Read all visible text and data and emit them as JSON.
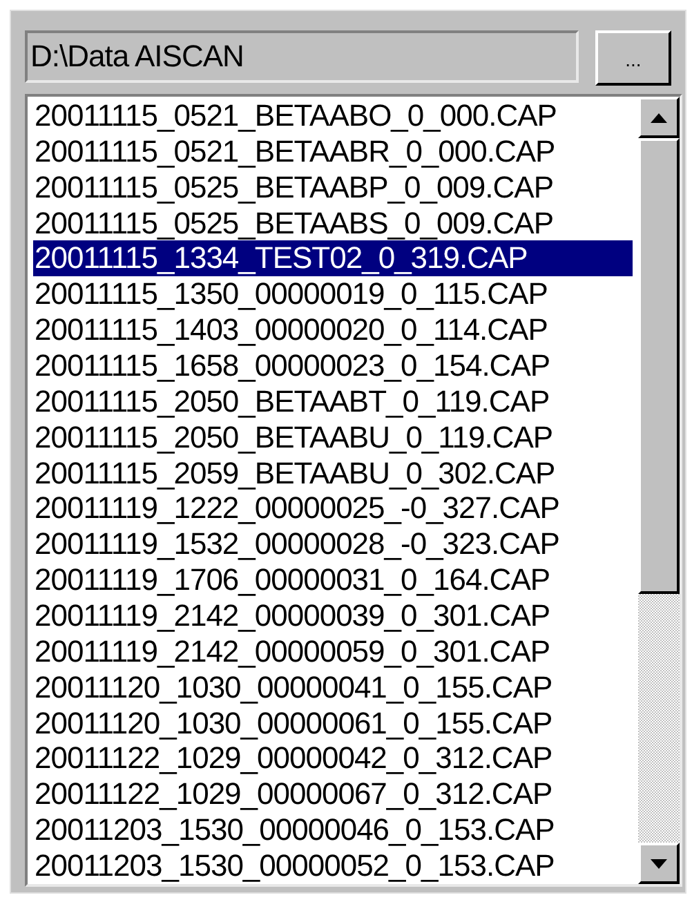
{
  "path_field": {
    "value": "D:\\Data AISCAN"
  },
  "browse_button": {
    "label": "..."
  },
  "file_list": [
    {
      "name": "20011115_0521_BETAABO_0_000.CAP",
      "selected": false
    },
    {
      "name": "20011115_0521_BETAABR_0_000.CAP",
      "selected": false
    },
    {
      "name": "20011115_0525_BETAABP_0_009.CAP",
      "selected": false
    },
    {
      "name": "20011115_0525_BETAABS_0_009.CAP",
      "selected": false
    },
    {
      "name": "20011115_1334_TEST02_0_319.CAP",
      "selected": true
    },
    {
      "name": "20011115_1350_00000019_0_115.CAP",
      "selected": false
    },
    {
      "name": "20011115_1403_00000020_0_114.CAP",
      "selected": false
    },
    {
      "name": "20011115_1658_00000023_0_154.CAP",
      "selected": false
    },
    {
      "name": "20011115_2050_BETAABT_0_119.CAP",
      "selected": false
    },
    {
      "name": "20011115_2050_BETAABU_0_119.CAP",
      "selected": false
    },
    {
      "name": "20011115_2059_BETAABU_0_302.CAP",
      "selected": false
    },
    {
      "name": "20011119_1222_00000025_-0_327.CAP",
      "selected": false
    },
    {
      "name": "20011119_1532_00000028_-0_323.CAP",
      "selected": false
    },
    {
      "name": "20011119_1706_00000031_0_164.CAP",
      "selected": false
    },
    {
      "name": "20011119_2142_00000039_0_301.CAP",
      "selected": false
    },
    {
      "name": "20011119_2142_00000059_0_301.CAP",
      "selected": false
    },
    {
      "name": "20011120_1030_00000041_0_155.CAP",
      "selected": false
    },
    {
      "name": "20011120_1030_00000061_0_155.CAP",
      "selected": false
    },
    {
      "name": "20011122_1029_00000042_0_312.CAP",
      "selected": false
    },
    {
      "name": "20011122_1029_00000067_0_312.CAP",
      "selected": false
    },
    {
      "name": "20011203_1530_00000046_0_153.CAP",
      "selected": false
    },
    {
      "name": "20011203_1530_00000052_0_153.CAP",
      "selected": false
    }
  ]
}
